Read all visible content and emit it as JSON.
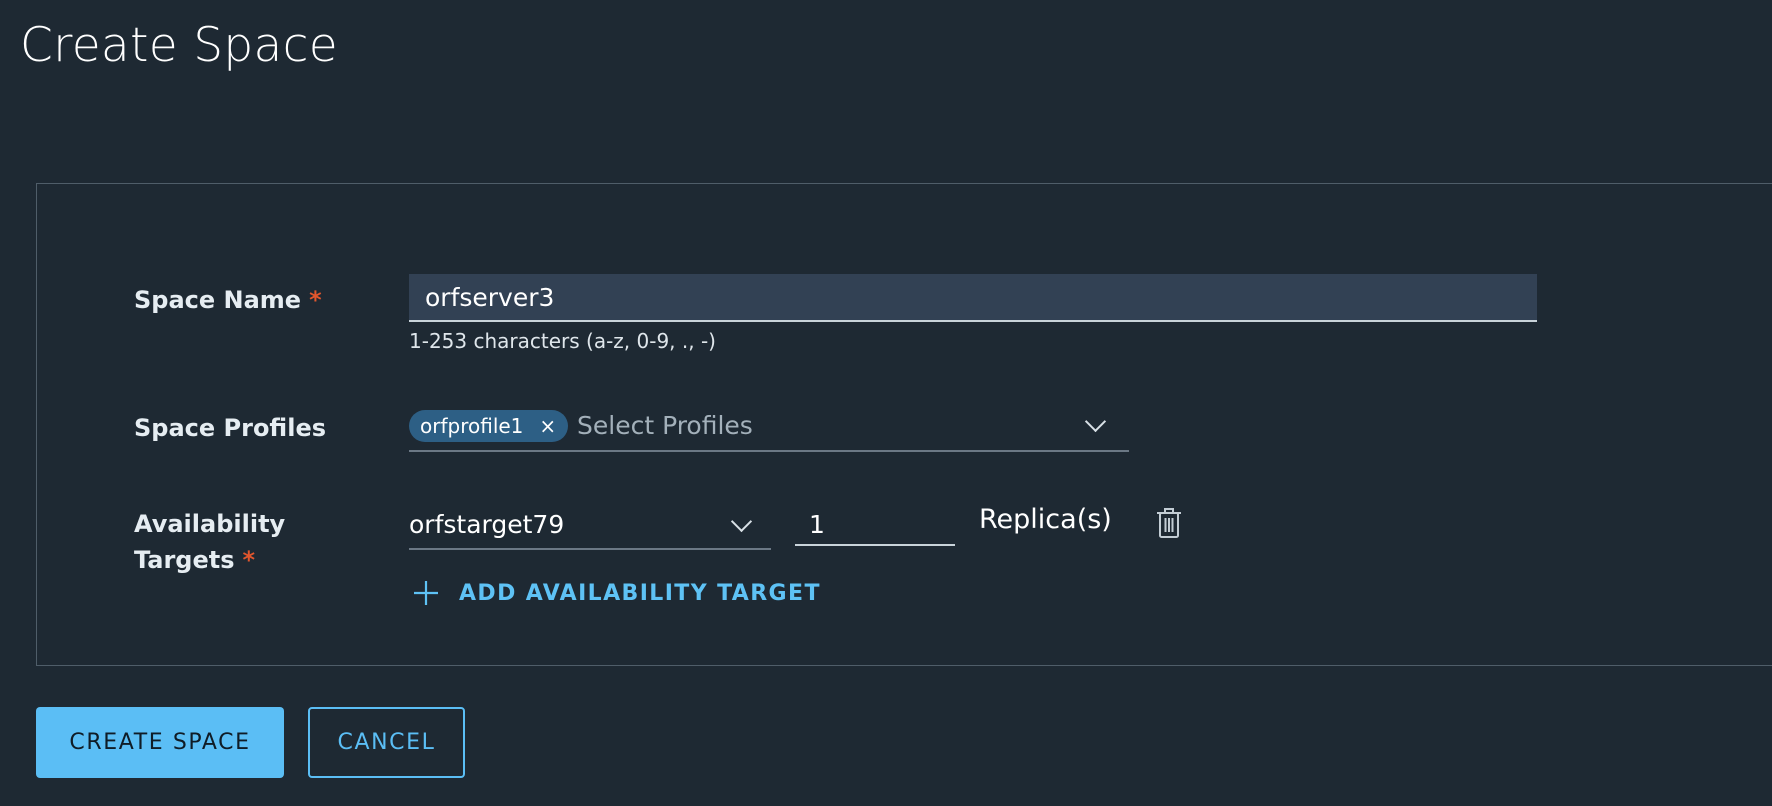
{
  "page": {
    "title": "Create Space"
  },
  "form": {
    "space_name": {
      "label": "Space Name",
      "required_marker": "*",
      "value": "orfserver3",
      "hint": "1-253 characters (a-z, 0-9, ., -)"
    },
    "space_profiles": {
      "label": "Space Profiles",
      "selected": [
        "orfprofile1"
      ],
      "remove_glyph": "×",
      "placeholder": "Select Profiles"
    },
    "availability_targets": {
      "label_line1": "Availability",
      "label_line2": "Targets",
      "required_marker": "*",
      "rows": [
        {
          "target": "orfstarget79",
          "replicas": "1",
          "replicas_label": "Replica(s)"
        }
      ],
      "add_label": "ADD AVAILABILITY TARGET"
    }
  },
  "actions": {
    "create_label": "CREATE SPACE",
    "cancel_label": "CANCEL"
  },
  "icons": {
    "chevron": "chevron-down-icon",
    "trash": "trash-icon",
    "plus": "plus-icon",
    "close": "close-icon"
  },
  "colors": {
    "background": "#1e2933",
    "accent": "#5bbef5",
    "required": "#e2562d",
    "chip": "#2d5f85",
    "input_fill": "#324154"
  }
}
